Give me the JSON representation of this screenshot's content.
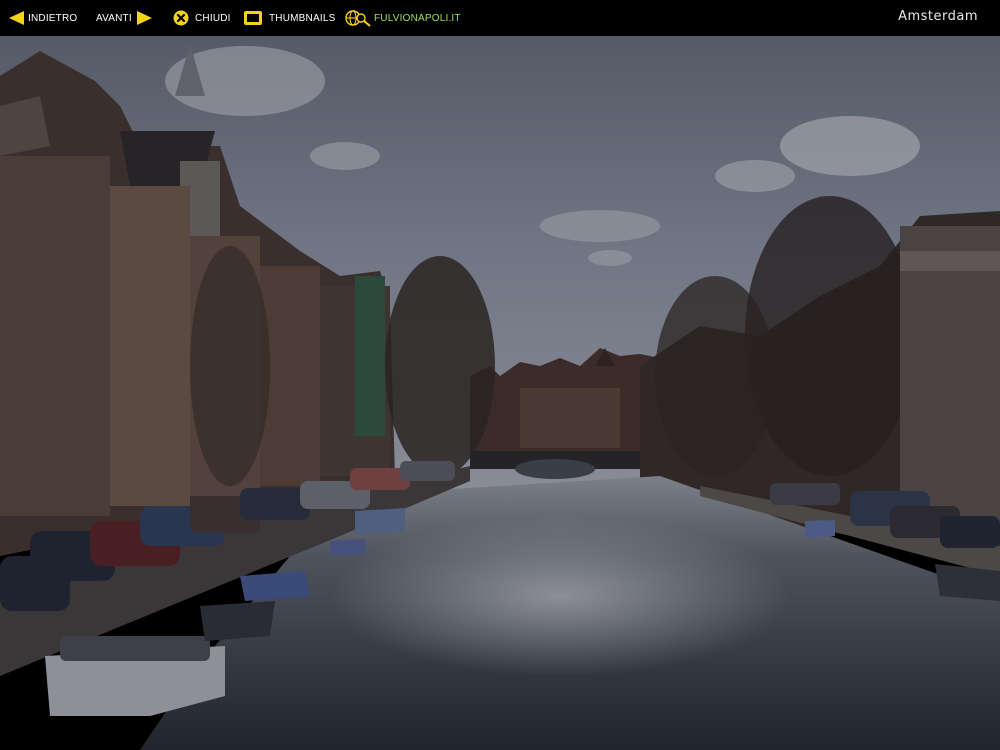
{
  "toolbar": {
    "back_label": "INDIETRO",
    "forward_label": "AVANTI",
    "close_label": "CHIUDI",
    "thumbnails_label": "THUMBNAILS",
    "site_label": "FULVIONAPOLI.IT"
  },
  "page_title": "Amsterdam",
  "colors": {
    "accent_yellow": "#f5d21c",
    "link_green": "#9de15a",
    "bar_background": "#000000"
  },
  "icons": {
    "back": "arrow-left-icon",
    "forward": "arrow-right-icon",
    "close": "close-circle-icon",
    "thumbnails": "thumbnails-frame-icon",
    "site": "globe-magnifier-icon"
  },
  "photo": {
    "subject": "Amsterdam canal photograph"
  }
}
